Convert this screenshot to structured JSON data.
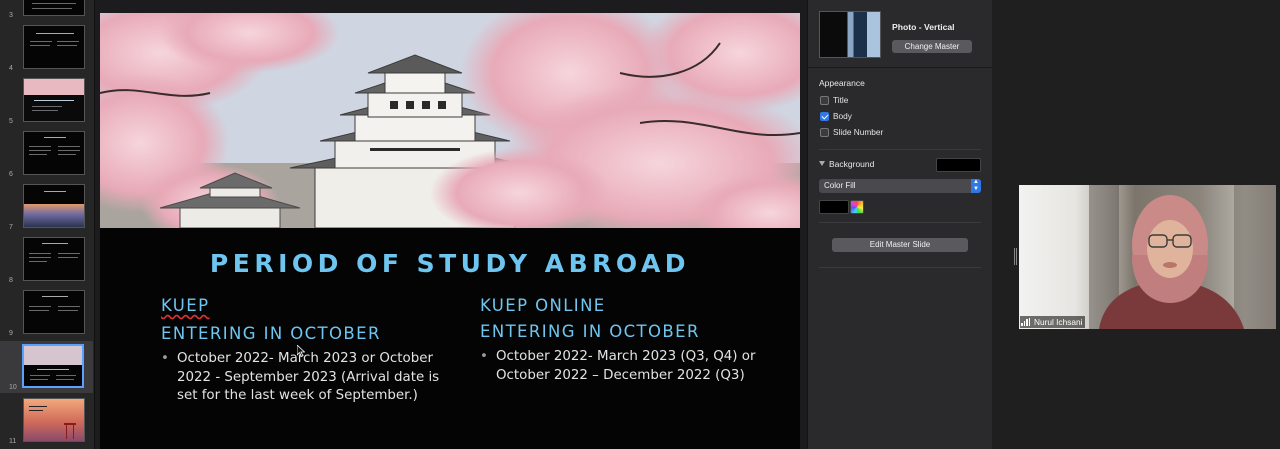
{
  "navigator": {
    "slides": [
      {
        "number": "3",
        "theme": "dark"
      },
      {
        "number": "4",
        "theme": "dark"
      },
      {
        "number": "5",
        "theme": "blossom"
      },
      {
        "number": "6",
        "theme": "dark"
      },
      {
        "number": "7",
        "theme": "city"
      },
      {
        "number": "8",
        "theme": "dark"
      },
      {
        "number": "9",
        "theme": "dark"
      },
      {
        "number": "10",
        "theme": "castle",
        "selected": true
      },
      {
        "number": "11",
        "theme": "torii"
      }
    ]
  },
  "slide": {
    "title": "PERIOD OF STUDY ABROAD",
    "left": {
      "heading_1": "KUEP",
      "heading_2": "ENTERING IN OCTOBER",
      "bullet": "October 2022- March 2023 or October 2022 - September 2023 (Arrival date is set for the last week of September.)"
    },
    "right": {
      "heading_1": "KUEP ONLINE",
      "heading_2": "ENTERING IN OCTOBER",
      "bullet": "October 2022- March 2023 (Q3, Q4) or October 2022 – December 2022 (Q3)"
    }
  },
  "inspector": {
    "master_name": "Photo - Vertical",
    "change_master_label": "Change Master",
    "appearance_label": "Appearance",
    "checkboxes": [
      {
        "label": "Title",
        "checked": false
      },
      {
        "label": "Body",
        "checked": true
      },
      {
        "label": "Slide Number",
        "checked": false
      }
    ],
    "background_label": "Background",
    "fill_type": "Color Fill",
    "fill_color": "#000000",
    "edit_master_label": "Edit Master Slide"
  },
  "video": {
    "participant_name": "Nurul Ichsani"
  },
  "colors": {
    "accent_text": "#6ec6f0",
    "selection": "#5aa0ff",
    "checkbox_on": "#2f78e6"
  }
}
